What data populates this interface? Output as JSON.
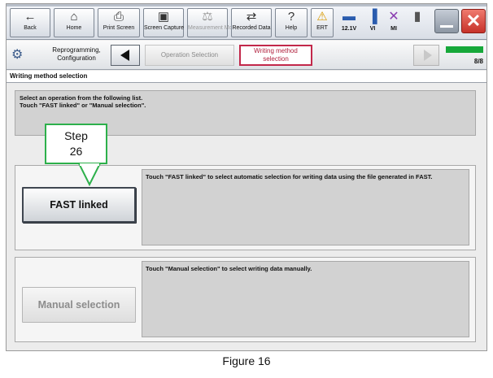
{
  "header": {
    "buttons": [
      {
        "label": "Back",
        "icon": "back-arrow-icon",
        "glyph": "←"
      },
      {
        "label": "Home",
        "icon": "home-icon",
        "glyph": "⌂"
      },
      {
        "label": "Print Screen",
        "icon": "printer-icon",
        "glyph": "⎙"
      },
      {
        "label": "Screen Capture",
        "icon": "camera-icon",
        "glyph": "▣"
      },
      {
        "label": "Measurement Mode",
        "icon": "measurement-icon",
        "glyph": "⚖"
      },
      {
        "label": "Recorded Data",
        "icon": "recorded-data-icon",
        "glyph": "⇄"
      },
      {
        "label": "Help",
        "icon": "help-icon",
        "glyph": "?"
      },
      {
        "label": "ERT",
        "icon": "warning-icon",
        "glyph": "⚠"
      }
    ],
    "status": [
      {
        "label": "12.1V",
        "icon": "car-battery-icon",
        "glyph": "▬"
      },
      {
        "label": "VI",
        "icon": "signal-icon",
        "glyph": "▐"
      },
      {
        "label": "MI",
        "icon": "disconnected-icon",
        "glyph": "✕"
      }
    ]
  },
  "breadcrumb": {
    "home_label": "Reprogramming, Configuration",
    "step1": "Operation Selection",
    "step2": "Writing method selection",
    "page_count": "8/8",
    "progress": 1.0
  },
  "section_title": "Writing method selection",
  "instruction": {
    "line1": "Select an operation from the following list.",
    "line2": "Touch \"FAST linked\" or \"Manual selection\"."
  },
  "options": {
    "fast": {
      "button": "FAST linked",
      "description": "Touch \"FAST linked\" to select automatic selection for writing data using the file generated in FAST."
    },
    "manual": {
      "button": "Manual selection",
      "description": "Touch \"Manual selection\" to select writing data manually."
    }
  },
  "callout": {
    "line1": "Step",
    "line2": "26"
  },
  "caption": "Figure 16",
  "colors": {
    "accent_red": "#c2284a",
    "callout_green": "#2db04b",
    "progress_green": "#17a83a"
  }
}
